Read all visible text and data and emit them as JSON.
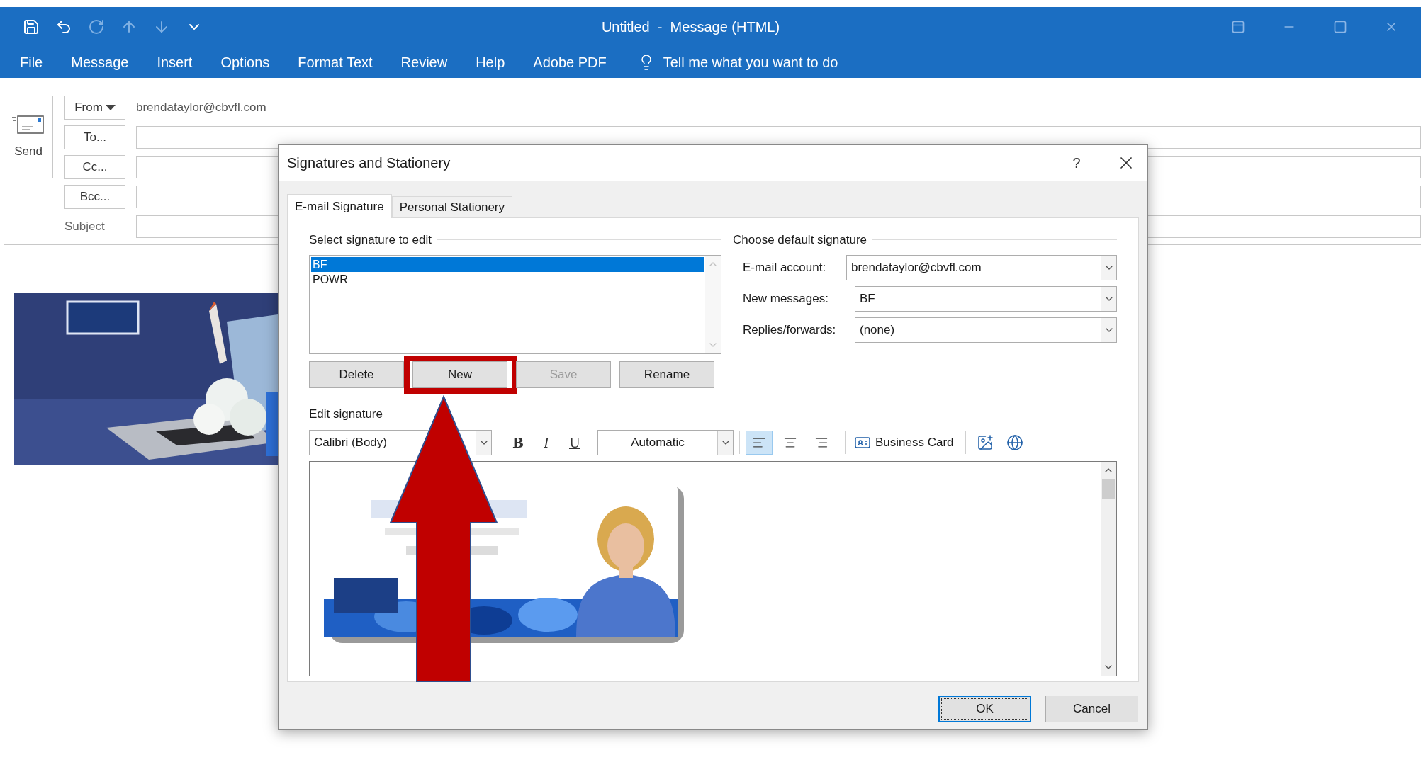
{
  "window": {
    "title": "Untitled  -  Message (HTML)"
  },
  "quick_access": [
    {
      "kind": "save",
      "disabled": false
    },
    {
      "kind": "undo",
      "disabled": false
    },
    {
      "kind": "redo",
      "disabled": true
    },
    {
      "kind": "up",
      "disabled": true
    },
    {
      "kind": "down",
      "disabled": true
    },
    {
      "kind": "customize",
      "disabled": false
    }
  ],
  "ribbon_tabs": [
    "File",
    "Message",
    "Insert",
    "Options",
    "Format Text",
    "Review",
    "Help",
    "Adobe PDF"
  ],
  "tell_me": {
    "placeholder": "Tell me what you want to do"
  },
  "send_button": {
    "label": "Send"
  },
  "from": {
    "label": "From",
    "value": "brendataylor@cbvfl.com"
  },
  "address_fields": [
    {
      "label": "To..."
    },
    {
      "label": "Cc..."
    },
    {
      "label": "Bcc..."
    }
  ],
  "subject": {
    "label": "Subject"
  },
  "dialog": {
    "title": "Signatures and Stationery",
    "help": "?",
    "tabs": [
      {
        "label": "E-mail Signature",
        "selected": true
      },
      {
        "label": "Personal Stationery",
        "selected": false
      }
    ],
    "select_section": {
      "heading": "Select signature to edit",
      "signatures": [
        {
          "name": "BF",
          "selected": true
        },
        {
          "name": "POWR",
          "selected": false
        }
      ],
      "buttons": [
        {
          "label": "Delete",
          "disabled": false,
          "highlighted": false
        },
        {
          "label": "New",
          "disabled": false,
          "highlighted": true
        },
        {
          "label": "Save",
          "disabled": true,
          "highlighted": false
        },
        {
          "label": "Rename",
          "disabled": false,
          "highlighted": false
        }
      ]
    },
    "default_section": {
      "heading": "Choose default signature",
      "fields": [
        {
          "label": "E-mail account:",
          "value": "brendataylor@cbvfl.com"
        },
        {
          "label": "New messages:",
          "value": "BF"
        },
        {
          "label": "Replies/forwards:",
          "value": "(none)"
        }
      ]
    },
    "edit_section": {
      "heading": "Edit signature",
      "font": "Calibri (Body)",
      "format_buttons": [
        {
          "label": "B",
          "kind": "bold"
        },
        {
          "label": "I",
          "kind": "italic"
        },
        {
          "label": "U",
          "kind": "underline"
        }
      ],
      "font_color": "Automatic",
      "align_buttons": [
        {
          "kind": "left",
          "selected": true
        },
        {
          "kind": "center",
          "selected": false
        },
        {
          "kind": "right",
          "selected": false
        }
      ],
      "business_card": "Business Card"
    },
    "buttons": [
      {
        "label": "OK",
        "default": true
      },
      {
        "label": "Cancel",
        "default": false
      }
    ]
  }
}
